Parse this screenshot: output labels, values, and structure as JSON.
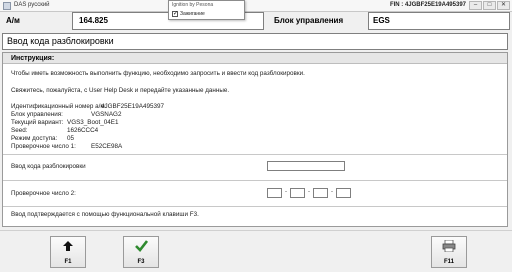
{
  "window": {
    "title": "DAS русский",
    "fin": "FIN : 4JGBF25E19A495397",
    "buttons": [
      "–",
      "□",
      "✕"
    ]
  },
  "popup": {
    "title": "Ignition by Pesona",
    "checkbox_label": "Зажигание",
    "checked": true
  },
  "header": {
    "am_label": "А/м",
    "am_value": "164.825",
    "unit_label": "Блок управления",
    "unit_value": "EGS"
  },
  "section_title": "Ввод кода разблокировки",
  "instructions": {
    "heading": "Инструкция:",
    "line1": "Чтобы иметь возможность выполнить функцию, необходимо запросить и ввести код разблокировки.",
    "line2": "Свяжитесь, пожалуйста, с User Help Desk и передайте указанные данные.",
    "vehicle_id_label": "Идентификационный номер а/м:",
    "vehicle_id_value": "4JGBF25E19A495397",
    "rows": [
      {
        "label": "Блок управления:",
        "value": "VGSNAG2"
      },
      {
        "label": "Текущий вариант:",
        "value": "VGS3_Boot_04E1"
      },
      {
        "label": "Seed:",
        "value": "1626CCC4"
      },
      {
        "label": "Режим доступа:",
        "value": "05"
      },
      {
        "label": "Проверочное число 1:",
        "value": "E52CE98A"
      }
    ]
  },
  "form": {
    "code_label": "Ввод кода разблокировки",
    "check_label": "Проверочное число 2:",
    "check_separator": "-",
    "confirm_hint": "Ввод подтверждается с помощью функциональной клавиши F3."
  },
  "fkeys": [
    {
      "key": "F1",
      "icon": "up-arrow-icon"
    },
    {
      "key": "F3",
      "icon": "checkmark-icon"
    },
    {
      "key": "F11",
      "icon": "printer-icon"
    }
  ],
  "colors": {
    "checkmark": "#2f8a2f",
    "background": "#f0f0f0"
  }
}
